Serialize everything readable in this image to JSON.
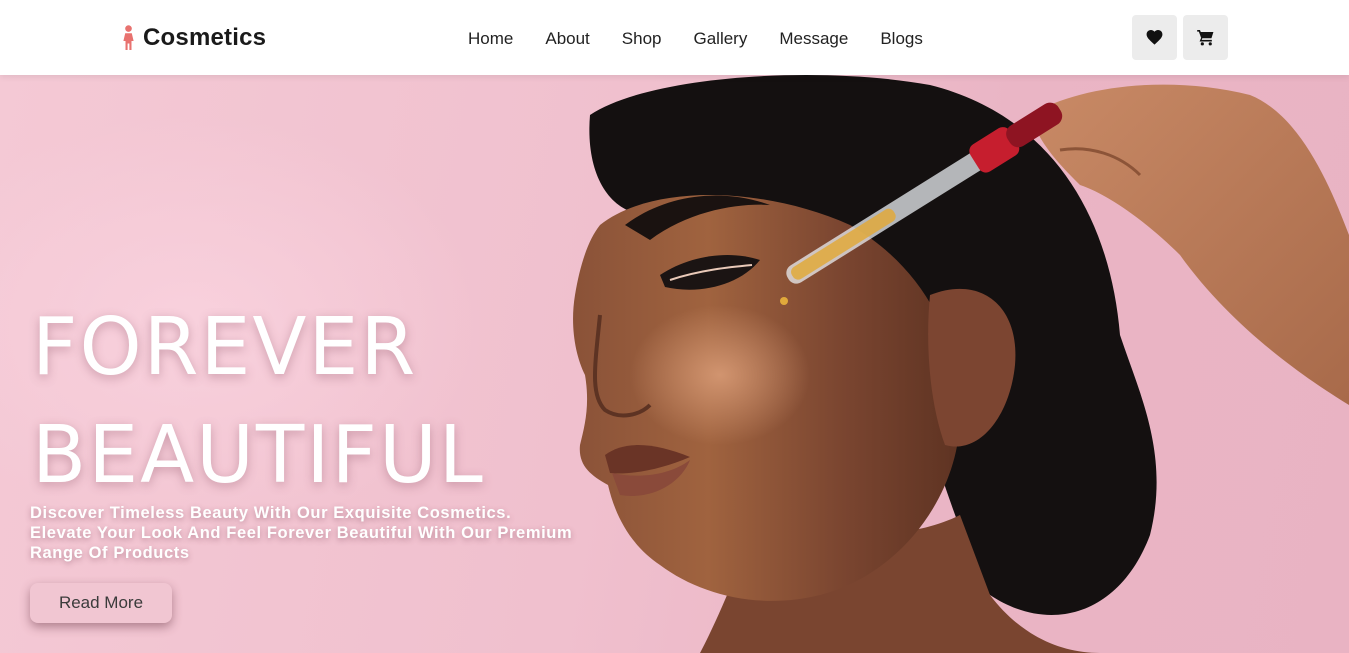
{
  "brand": {
    "name": "Cosmetics",
    "icon": "woman-figure-icon"
  },
  "nav": {
    "items": [
      {
        "label": "Home"
      },
      {
        "label": "About"
      },
      {
        "label": "Shop"
      },
      {
        "label": "Gallery"
      },
      {
        "label": "Message"
      },
      {
        "label": "Blogs"
      }
    ]
  },
  "actions": {
    "wishlist_icon": "heart-icon",
    "cart_icon": "cart-icon"
  },
  "hero": {
    "title_line1": "FOREVER",
    "title_line2": "BEAUTIFUL",
    "subtitle_line1": "Discover Timeless Beauty With Our Exquisite Cosmetics.",
    "subtitle_line2": "Elevate Your Look And Feel Forever Beautiful With Our Premium",
    "subtitle_line3": "Range Of Products",
    "cta_label": "Read More"
  },
  "colors": {
    "brand_icon": "#e8726f",
    "hero_background": "#f0c0ce",
    "button_background": "#f1c6d2",
    "icon_button_background": "#ececec"
  }
}
